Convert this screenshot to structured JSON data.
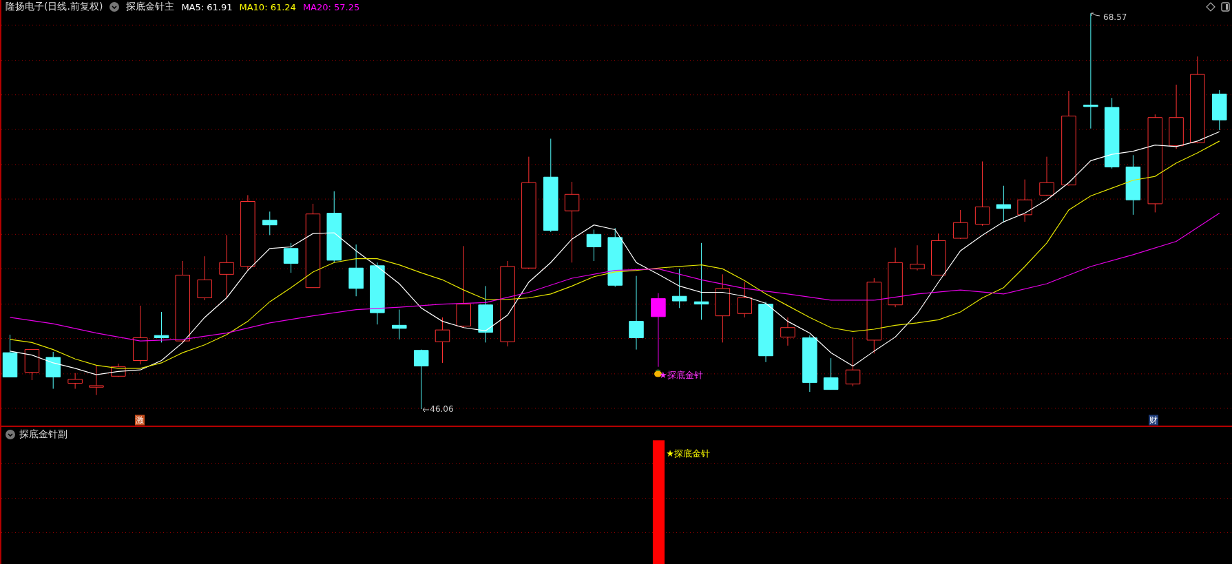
{
  "header": {
    "stock_title": "隆扬电子(日线.前复权)",
    "indicator": "探底金针主",
    "moving_averages": [
      {
        "label": "MA5: 61.91",
        "color": "#ffffff"
      },
      {
        "label": "MA10: 61.24",
        "color": "#ffff00"
      },
      {
        "label": "MA20: 57.25",
        "color": "#ff00ff"
      }
    ]
  },
  "main_chart": {
    "high_label": "68.57",
    "low_label": "46.06",
    "signal_label": "★探底金针",
    "event_badges": [
      {
        "text": "激",
        "color": "#c8501e"
      },
      {
        "text": "财",
        "color": "#1e3c78"
      }
    ]
  },
  "sub_panel": {
    "title": "探底金针副",
    "signal_label": "★探底金针"
  }
}
